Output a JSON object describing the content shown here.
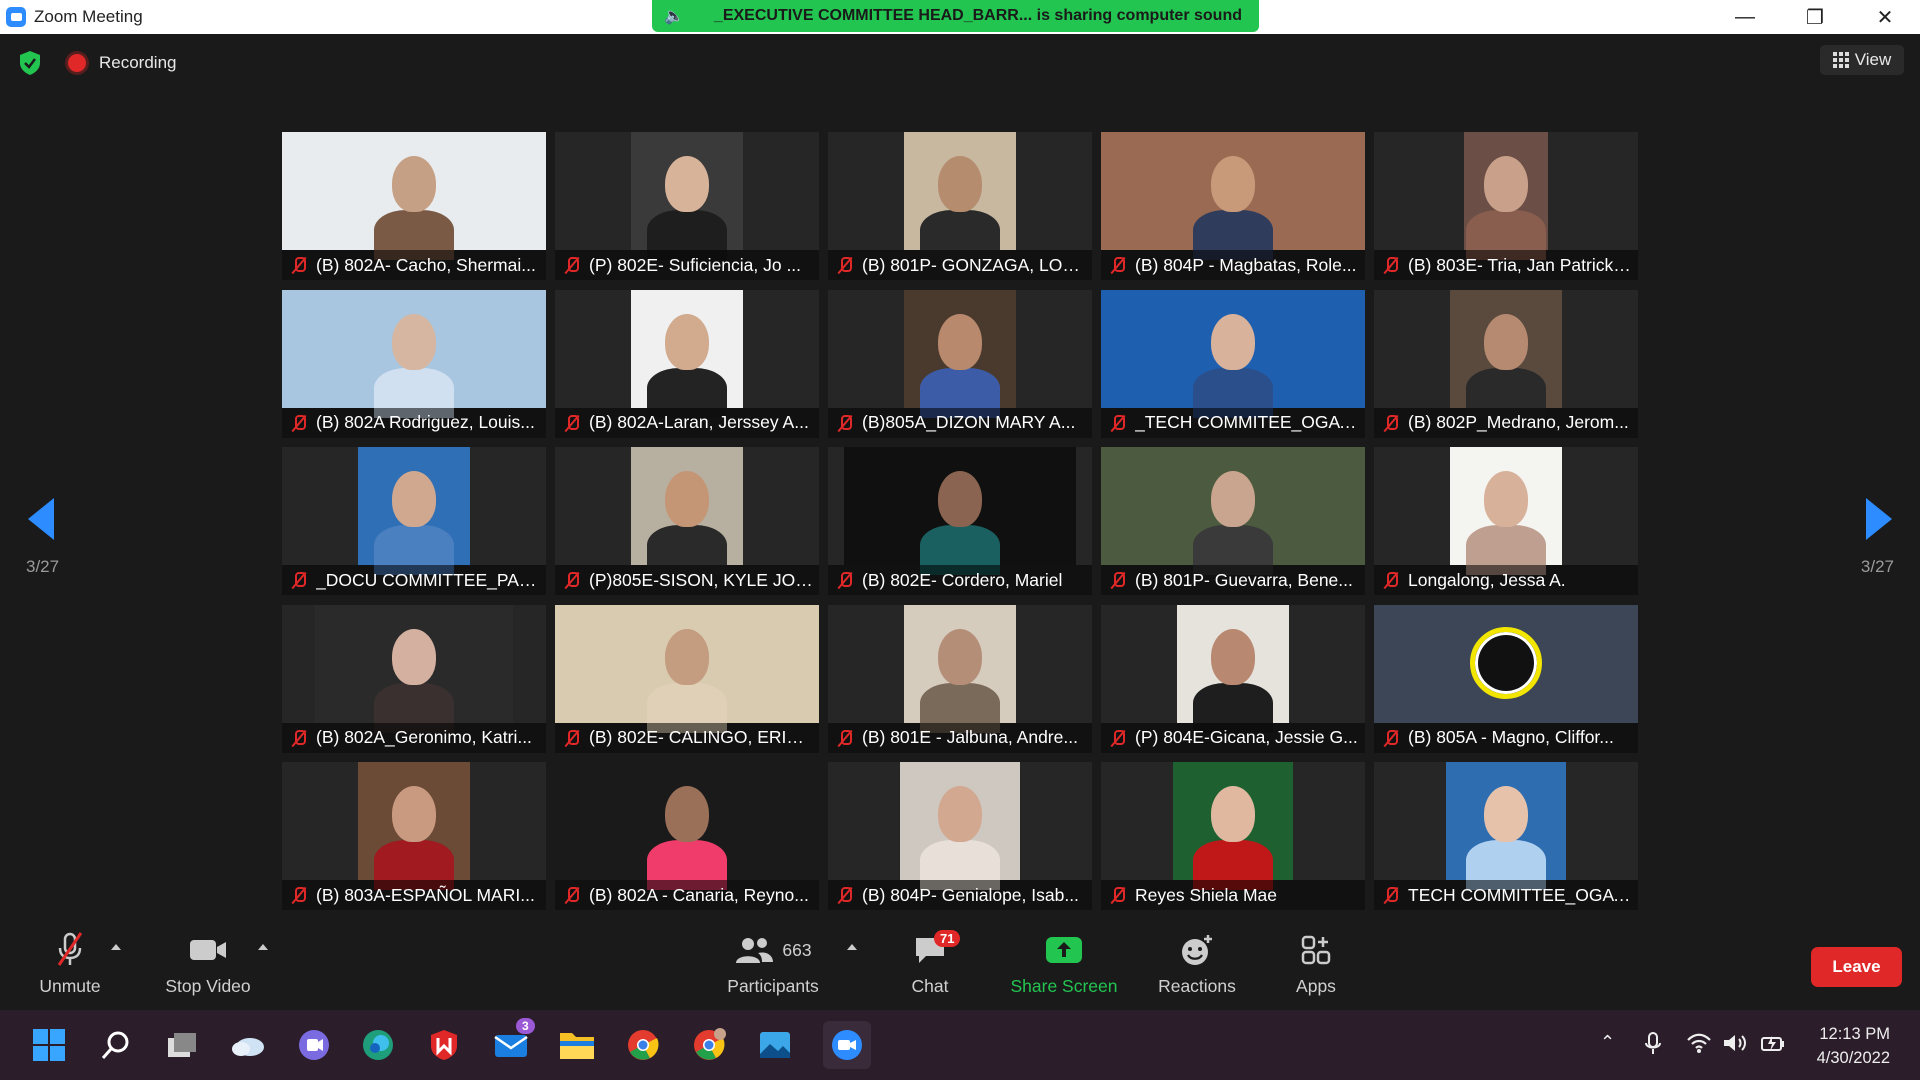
{
  "window": {
    "title": "Zoom Meeting"
  },
  "banner": {
    "text": "_EXECUTIVE COMMITTEE HEAD_BARR... is sharing computer sound"
  },
  "topbar": {
    "recording": "Recording",
    "view": "View"
  },
  "pager": {
    "left": "3/27",
    "right": "3/27"
  },
  "participants": [
    {
      "name": "(B) 802A- Cacho, Shermai..."
    },
    {
      "name": "(P) 802E- Suficiencia, Jo ..."
    },
    {
      "name": "(B) 801P- GONZAGA, LOU..."
    },
    {
      "name": "(B) 804P - Magbatas, Role..."
    },
    {
      "name": "(B) 803E- Tria, Jan Patrick ..."
    },
    {
      "name": "(B) 802A Rodriguez, Louis..."
    },
    {
      "name": "(B) 802A-Laran, Jerssey A..."
    },
    {
      "name": "(B)805A_DIZON MARY A..."
    },
    {
      "name": "_TECH COMMITEE_OGAY..."
    },
    {
      "name": "(B) 802P_Medrano, Jerom..."
    },
    {
      "name": "_DOCU COMMITTEE_PAR..."
    },
    {
      "name": "(P)805E-SISON, KYLE JON..."
    },
    {
      "name": "(B) 802E- Cordero, Mariel"
    },
    {
      "name": "(B) 801P- Guevarra, Bene..."
    },
    {
      "name": "Longalong, Jessa A."
    },
    {
      "name": "(B) 802A_Geronimo, Katri..."
    },
    {
      "name": "(B) 802E- CALINGO, ERIC..."
    },
    {
      "name": "(B) 801E - Jalbuna, Andre..."
    },
    {
      "name": "(P) 804E-Gicana, Jessie G..."
    },
    {
      "name": "(B) 805A - Magno, Cliffor..."
    },
    {
      "name": "(B) 803A-ESPAÑOL MARI..."
    },
    {
      "name": "(B) 802A - Canaria, Reyno..."
    },
    {
      "name": "(B) 804P- Genialope, Isab..."
    },
    {
      "name": "Reyes Shiela Mae"
    },
    {
      "name": "TECH COMMITTEE_OGAY..."
    }
  ],
  "toolbar": {
    "unmute": "Unmute",
    "stop_video": "Stop Video",
    "participants": "Participants",
    "participants_count": "663",
    "chat": "Chat",
    "chat_badge": "71",
    "share_screen": "Share Screen",
    "reactions": "Reactions",
    "apps": "Apps",
    "leave": "Leave"
  },
  "taskbar": {
    "mail_badge": "3",
    "time": "12:13 PM",
    "date": "4/30/2022"
  },
  "colors": {
    "accent": "#2d8cff",
    "share_green": "#23c551",
    "leave_red": "#e02828",
    "mic_red": "#e02828"
  }
}
